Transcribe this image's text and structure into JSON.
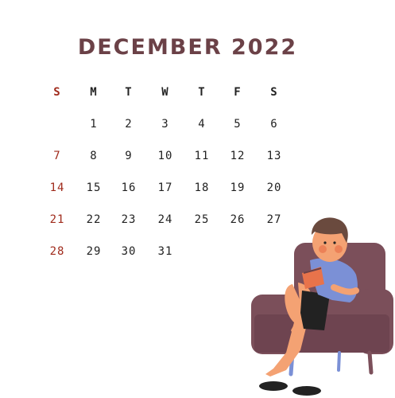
{
  "title": "DECEMBER 2022",
  "weekdays": [
    "S",
    "M",
    "T",
    "W",
    "T",
    "F",
    "S"
  ],
  "weeks": [
    [
      "",
      "",
      "1",
      "2",
      "3",
      "4",
      "5",
      "6"
    ],
    [
      "7",
      "8",
      "9",
      "10",
      "11",
      "12",
      "13"
    ],
    [
      "14",
      "15",
      "16",
      "17",
      "18",
      "19",
      "20"
    ],
    [
      "21",
      "22",
      "23",
      "24",
      "25",
      "26",
      "27"
    ],
    [
      "28",
      "29",
      "30",
      "31",
      "",
      "",
      ""
    ]
  ],
  "colors": {
    "title": "#6b4147",
    "sunday": "#a02b1c",
    "text": "#222222",
    "armchair": "#7b4f5a",
    "shirt": "#7b90d6",
    "skin": "#f4a273",
    "hair": "#6a4a3e",
    "shorts": "#222222"
  }
}
